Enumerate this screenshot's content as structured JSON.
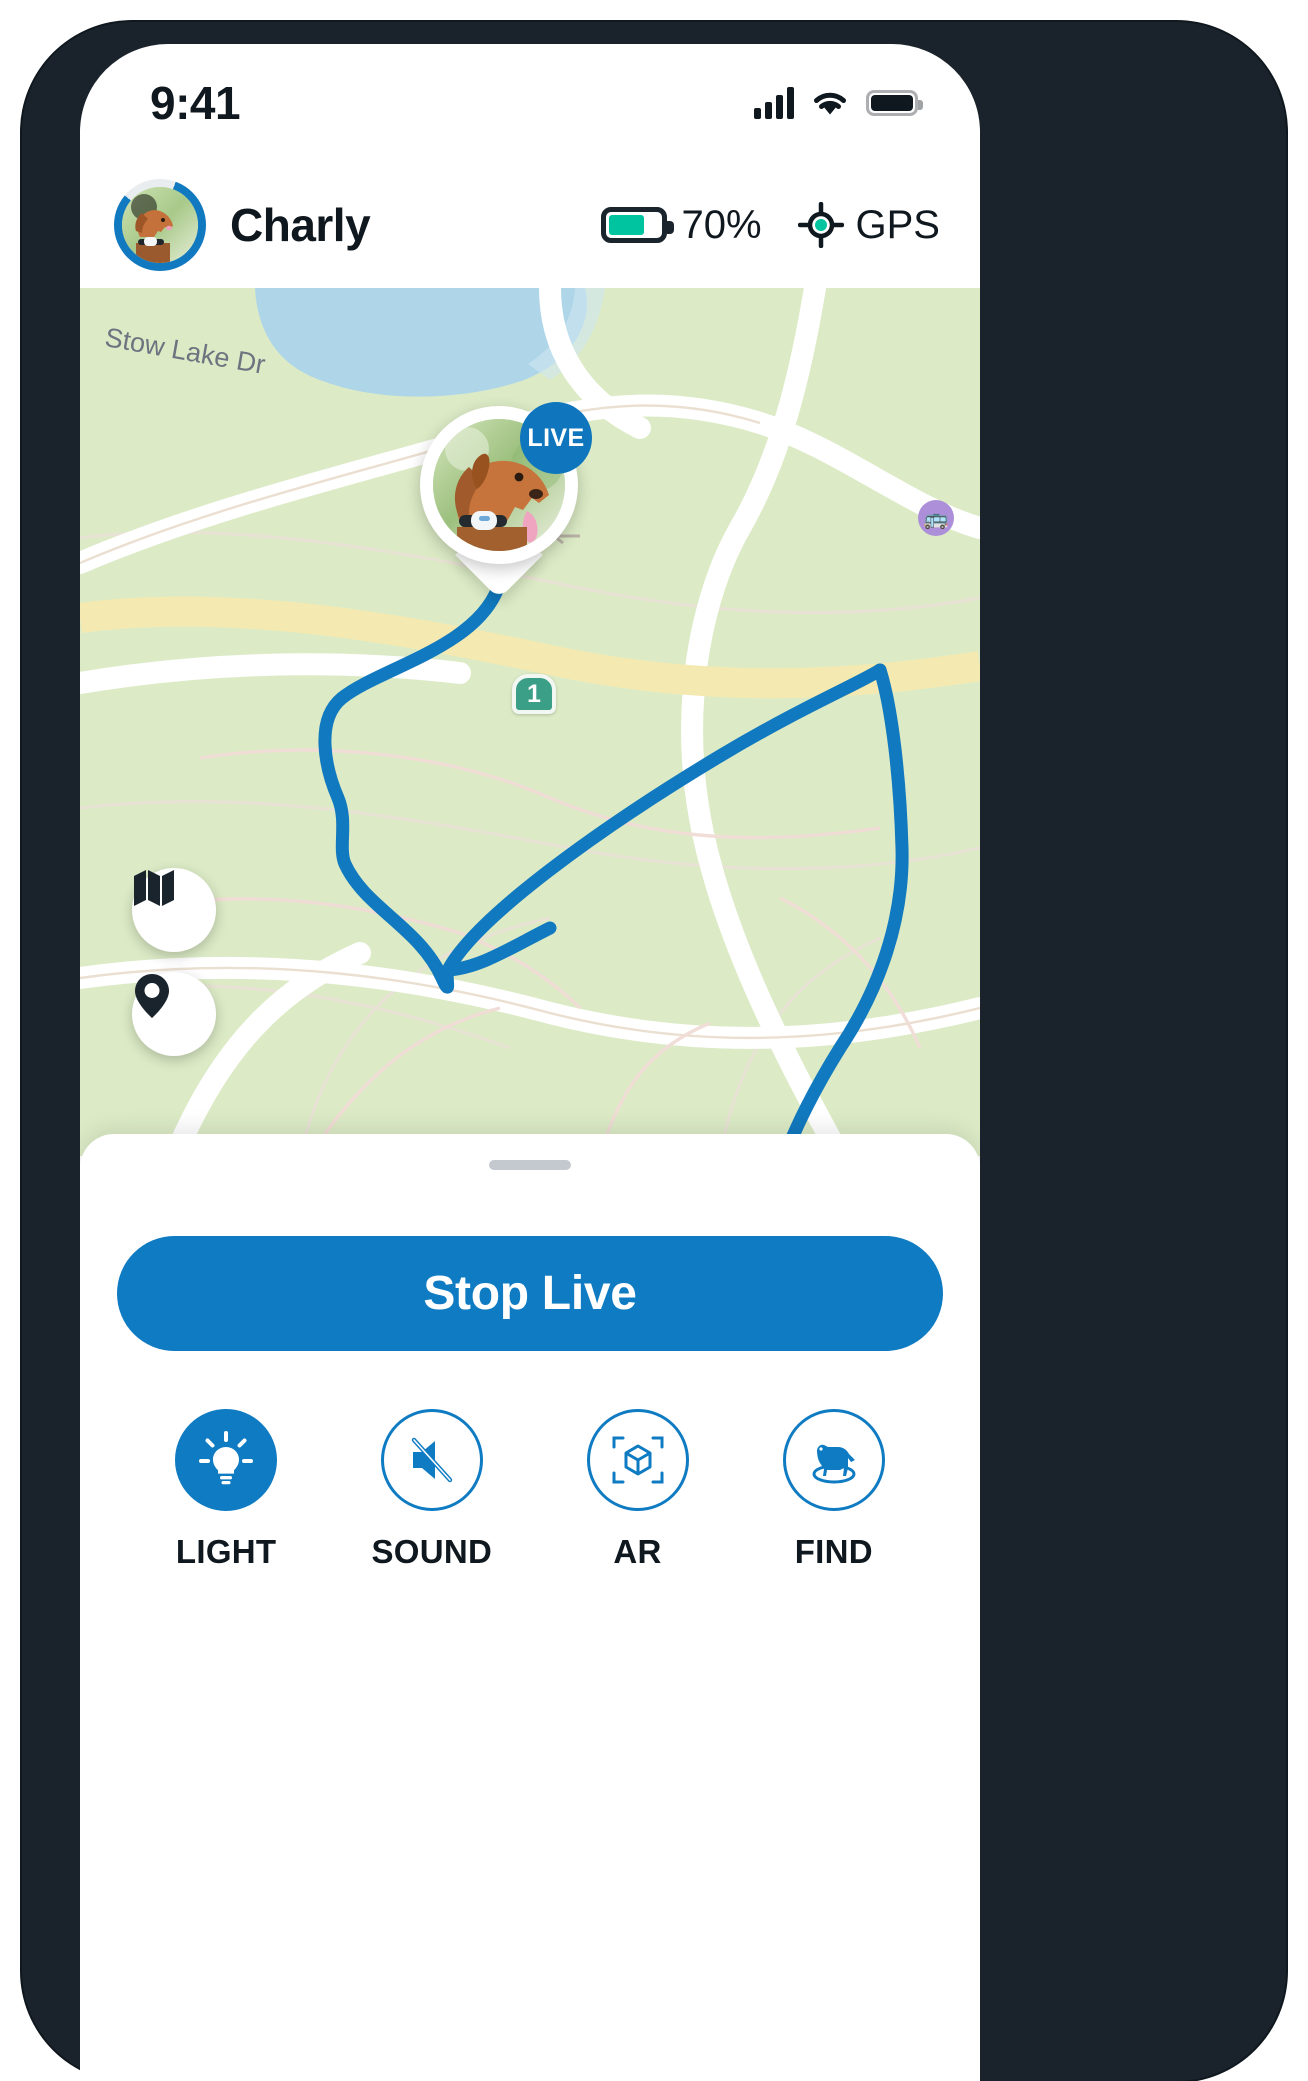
{
  "status_bar": {
    "time": "9:41",
    "signal_icon": "cellular-signal-icon",
    "wifi_icon": "wifi-icon",
    "battery_icon": "battery-icon"
  },
  "header": {
    "avatar_name": "pet-avatar",
    "pet_name": "Charly",
    "battery_percent": "70%",
    "battery_level": 70,
    "battery_color": "#00c4a0",
    "gps_label": "GPS",
    "gps_icon": "gps-crosshair-icon"
  },
  "map": {
    "street_label": "Stow Lake Dr",
    "highway_shield": "1",
    "live_badge": "LIVE",
    "pin_icon": "pet-location-pin",
    "controls": [
      {
        "name": "map-layers-button",
        "icon": "map-layers-icon"
      },
      {
        "name": "locate-button",
        "icon": "location-pin-icon"
      }
    ],
    "track_color": "#1179bf",
    "land_color": "#d9e8c3",
    "water_color": "#aed5e8",
    "road_color": "#ffffff",
    "highway_color": "#fbf0b8"
  },
  "sheet": {
    "grabber": "sheet-drag-handle",
    "primary_button": "Stop Live",
    "primary_button_color": "#0f7bc2",
    "actions": [
      {
        "label": "LIGHT",
        "icon": "lightbulb-icon",
        "active": true
      },
      {
        "label": "SOUND",
        "icon": "speaker-muted-icon",
        "active": false
      },
      {
        "label": "AR",
        "icon": "ar-cube-icon",
        "active": false
      },
      {
        "label": "FIND",
        "icon": "dog-radar-icon",
        "active": false
      }
    ]
  }
}
